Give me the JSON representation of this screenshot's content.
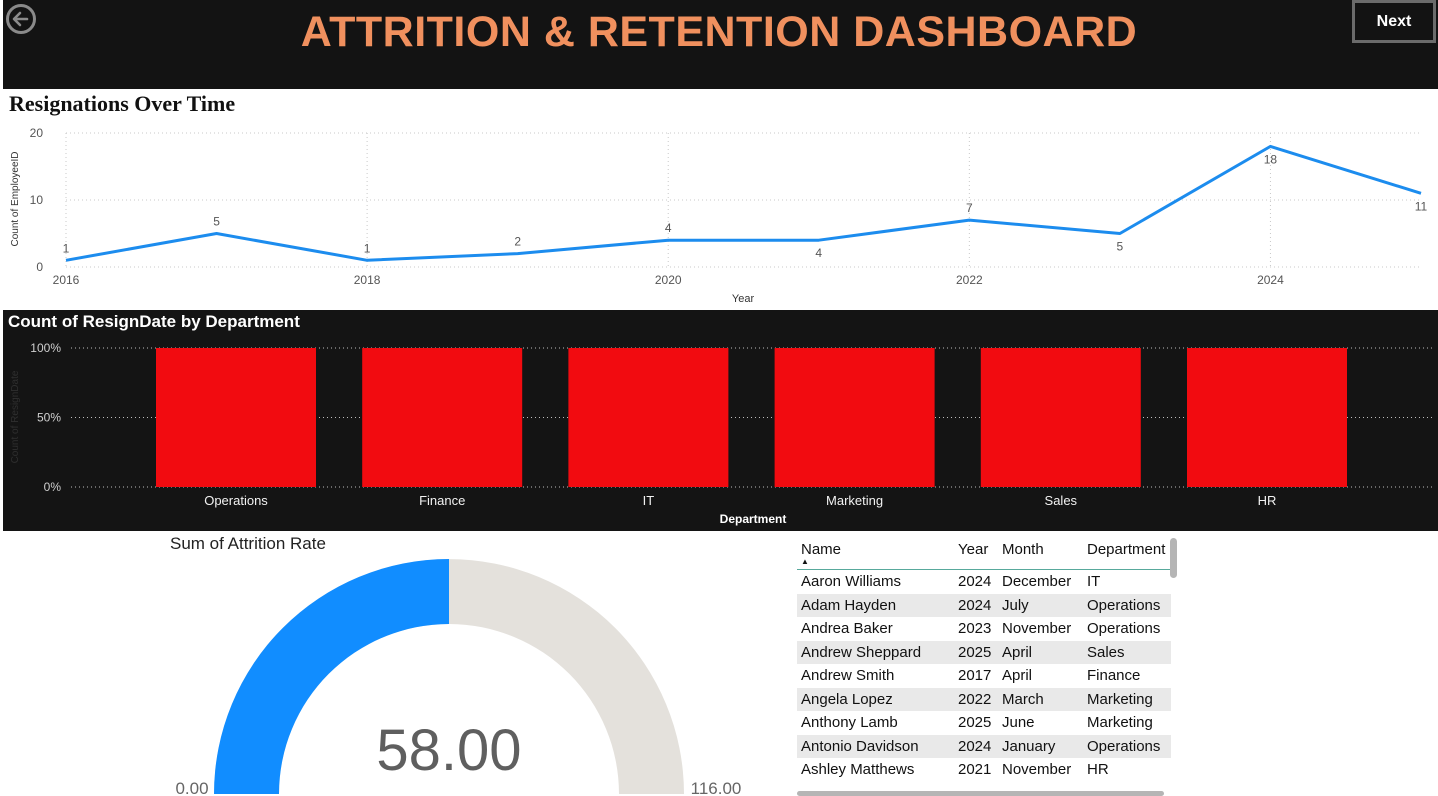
{
  "header": {
    "title": "ATTRITION & RETENTION DASHBOARD",
    "next_label": "Next",
    "back_icon": "arrow-left-circle-icon",
    "title_color": "#f0905e"
  },
  "line_chart": {
    "chart_data": {
      "type": "line",
      "title": "Resignations Over Time",
      "xlabel": "Year",
      "ylabel": "Count of EmployeeID",
      "x": [
        2016,
        2017,
        2018,
        2019,
        2020,
        2021,
        2022,
        2023,
        2024,
        2025
      ],
      "values": [
        1,
        5,
        1,
        2,
        4,
        4,
        7,
        5,
        18,
        11
      ],
      "xticks": [
        "2016",
        "2018",
        "2020",
        "2022",
        "2024"
      ],
      "yticks": [
        "0",
        "10",
        "20"
      ],
      "ylim": [
        0,
        20
      ],
      "color": "#1c8cee",
      "grid": true
    }
  },
  "bar_chart": {
    "chart_data": {
      "type": "bar",
      "title": "Count of ResignDate by Department",
      "xlabel": "Department",
      "ylabel": "Count of ResignDate",
      "categories": [
        "Operations",
        "Finance",
        "IT",
        "Marketing",
        "Sales",
        "HR"
      ],
      "values": [
        100,
        100,
        100,
        100,
        100,
        100
      ],
      "yticks": [
        "0%",
        "50%",
        "100%"
      ],
      "ylim": [
        0,
        100
      ],
      "color": "#f20b10",
      "grid": true
    }
  },
  "gauge": {
    "title": "Sum of Attrition Rate",
    "value": 58,
    "value_label": "58.00",
    "min_label": "0.00",
    "max_label": "116.00",
    "min": 0,
    "max": 116,
    "fill_color": "#118dff",
    "track_color": "#e4e1dc"
  },
  "table": {
    "columns": [
      "Name",
      "Year",
      "Month",
      "Department"
    ],
    "rows": [
      [
        "Aaron Williams",
        "2024",
        "December",
        "IT"
      ],
      [
        "Adam Hayden",
        "2024",
        "July",
        "Operations"
      ],
      [
        "Andrea Baker",
        "2023",
        "November",
        "Operations"
      ],
      [
        "Andrew Sheppard",
        "2025",
        "April",
        "Sales"
      ],
      [
        "Andrew Smith",
        "2017",
        "April",
        "Finance"
      ],
      [
        "Angela Lopez",
        "2022",
        "March",
        "Marketing"
      ],
      [
        "Anthony Lamb",
        "2025",
        "June",
        "Marketing"
      ],
      [
        "Antonio Davidson",
        "2024",
        "January",
        "Operations"
      ],
      [
        "Ashley Matthews",
        "2021",
        "November",
        "HR"
      ]
    ]
  }
}
